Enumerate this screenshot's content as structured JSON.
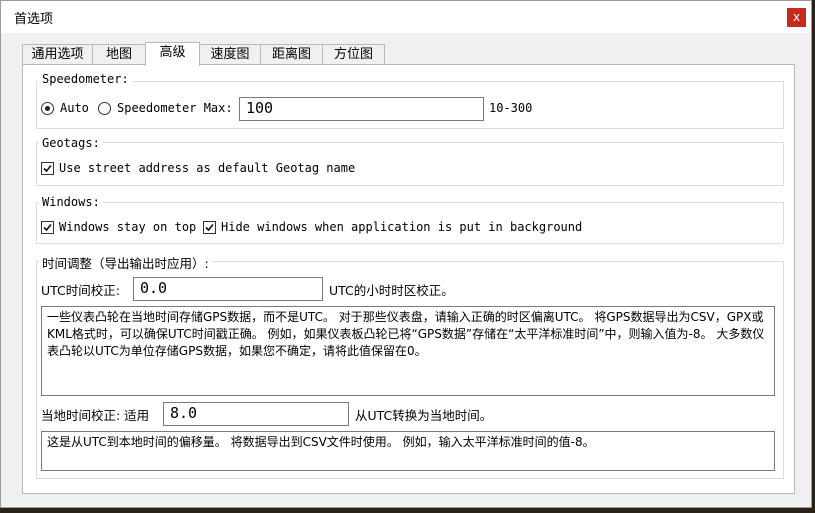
{
  "window": {
    "title": "首选项",
    "close_glyph": "x"
  },
  "tabs": [
    {
      "label": "通用选项"
    },
    {
      "label": "地图"
    },
    {
      "label": "高级",
      "active": true
    },
    {
      "label": "速度图"
    },
    {
      "label": "距离图"
    },
    {
      "label": "方位图"
    }
  ],
  "speedometer": {
    "legend": "Speedometer:",
    "auto_label": "Auto",
    "auto_selected": true,
    "max_label": "Speedometer Max:",
    "max_value": "100",
    "range_hint": "10-300"
  },
  "geotags": {
    "legend": "Geotags:",
    "street_label": "Use street address as default Geotag name",
    "street_checked": true
  },
  "windows": {
    "legend": "Windows:",
    "stay_on_top_label": "Windows stay on top",
    "stay_on_top_checked": true,
    "hide_label": "Hide windows when application is put in background",
    "hide_checked": true
  },
  "time": {
    "legend": "时间调整（导出输出时应用）:",
    "utc_label": "UTC时间校正:",
    "utc_value": "0.0",
    "utc_hint": "UTC的小时时区校正。",
    "utc_desc": "一些仪表凸轮在当地时间存储GPS数据，而不是UTC。 对于那些仪表盘，请输入正确的时区偏离UTC。 将GPS数据导出为CSV，GPX或KML格式时，可以确保UTC时间戳正确。 例如，如果仪表板凸轮已将“GPS数据”存储在“太平洋标准时间”中，则输入值为-8。 大多数仪表凸轮以UTC为单位存储GPS数据，如果您不确定，请将此值保留在0。",
    "local_label": "当地时间校正: 适用",
    "local_value": "8.0",
    "local_hint": "从UTC转换为当地时间。",
    "local_desc": "这是从UTC到本地时间的偏移量。 将数据导出到CSV文件时使用。 例如，输入太平洋标准时间的值-8。"
  }
}
